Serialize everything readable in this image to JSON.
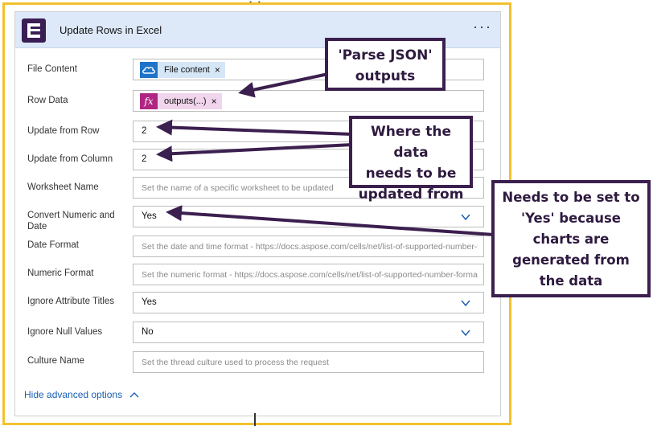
{
  "card": {
    "title": "Update Rows in Excel",
    "more_label": "···"
  },
  "fields": [
    {
      "label": "File Content",
      "token_text": "File content",
      "token_close": "×"
    },
    {
      "label": "Row Data",
      "token_text": "outputs(...)",
      "token_close": "×",
      "token_icon_text": "fx"
    },
    {
      "label": "Update from Row",
      "value": "2"
    },
    {
      "label": "Update from Column",
      "value": "2"
    },
    {
      "label": "Worksheet Name",
      "placeholder": "Set the name of a specific worksheet to be updated"
    },
    {
      "label": "Convert Numeric and Date",
      "value": "Yes"
    },
    {
      "label": "Date Format",
      "placeholder": "Set the date and time format - https://docs.aspose.com/cells/net/list-of-supported-number-formats"
    },
    {
      "label": "Numeric Format",
      "placeholder": "Set the numeric format - https://docs.aspose.com/cells/net/list-of-supported-number-formats"
    },
    {
      "label": "Ignore Attribute Titles",
      "value": "Yes"
    },
    {
      "label": "Ignore Null Values",
      "value": "No"
    },
    {
      "label": "Culture Name",
      "placeholder": "Set the thread culture used to process the request"
    }
  ],
  "hide_advanced": "Hide advanced options",
  "callouts": {
    "parse_json": [
      "'Parse JSON'",
      "outputs"
    ],
    "where_data": [
      "Where the data",
      "needs to be",
      "updated from"
    ],
    "needs_yes": [
      "Needs to be set to",
      "'Yes' because",
      "charts are",
      "generated from",
      "the data"
    ]
  },
  "colors": {
    "card_border": "#f2c12e",
    "header_bg": "#dde9f8",
    "callout_border": "#3b1f4e",
    "link": "#1a5fb4"
  }
}
